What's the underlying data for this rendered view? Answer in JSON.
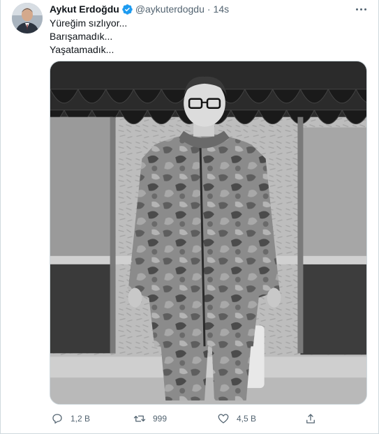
{
  "tweet": {
    "author_name": "Aykut Erdoğdu",
    "handle": "@aykuterdogdu",
    "separator": "·",
    "time": "14s",
    "verified": true,
    "lines": [
      "Yüreğim sızlıyor...",
      "Barışamadık...",
      "Yaşatamadık..."
    ],
    "media": {
      "kind": "photo",
      "style": "black-and-white"
    }
  },
  "actions": {
    "reply_count": "1,2 B",
    "retweet_count": "999",
    "like_count": "4,5 B"
  },
  "icons": {
    "verified": "verified-badge-icon",
    "more": "more-options-icon",
    "reply": "reply-icon",
    "retweet": "retweet-icon",
    "like": "like-icon",
    "share": "share-icon"
  },
  "colors": {
    "verified": "#1d9bf0",
    "text_primary": "#0f1419",
    "text_secondary": "#536471",
    "border": "#cfd9de"
  }
}
